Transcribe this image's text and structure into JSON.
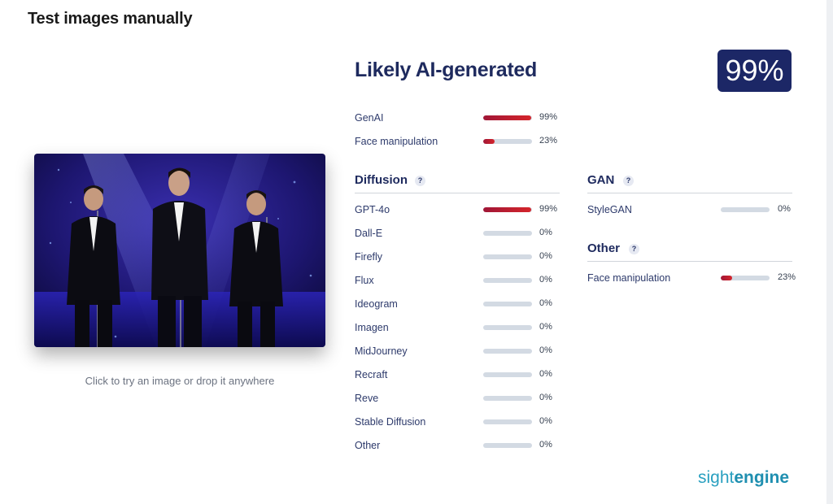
{
  "page": {
    "title": "Test images manually"
  },
  "upload": {
    "hint": "Click to try an image or drop it anywhere"
  },
  "result": {
    "verdict": "Likely AI-generated",
    "score_label": "99%"
  },
  "summary": [
    {
      "label": "GenAI",
      "value": 99,
      "display": "99%"
    },
    {
      "label": "Face manipulation",
      "value": 23,
      "display": "23%"
    }
  ],
  "diffusion": {
    "title": "Diffusion",
    "help": "?",
    "items": [
      {
        "label": "GPT-4o",
        "value": 99,
        "display": "99%"
      },
      {
        "label": "Dall-E",
        "value": 0,
        "display": "0%"
      },
      {
        "label": "Firefly",
        "value": 0,
        "display": "0%"
      },
      {
        "label": "Flux",
        "value": 0,
        "display": "0%"
      },
      {
        "label": "Ideogram",
        "value": 0,
        "display": "0%"
      },
      {
        "label": "Imagen",
        "value": 0,
        "display": "0%"
      },
      {
        "label": "MidJourney",
        "value": 0,
        "display": "0%"
      },
      {
        "label": "Recraft",
        "value": 0,
        "display": "0%"
      },
      {
        "label": "Reve",
        "value": 0,
        "display": "0%"
      },
      {
        "label": "Stable Diffusion",
        "value": 0,
        "display": "0%"
      },
      {
        "label": "Other",
        "value": 0,
        "display": "0%"
      }
    ]
  },
  "gan": {
    "title": "GAN",
    "help": "?",
    "items": [
      {
        "label": "StyleGAN",
        "value": 0,
        "display": "0%"
      }
    ]
  },
  "other": {
    "title": "Other",
    "help": "?",
    "items": [
      {
        "label": "Face manipulation",
        "value": 23,
        "display": "23%"
      }
    ]
  },
  "brand": {
    "part1": "sight",
    "part2": "engine"
  },
  "colors": {
    "accent": "#1c2766",
    "bar_fill": "#c81e2e",
    "bar_track": "#d3dae3",
    "brand": "#2aa0c0"
  }
}
